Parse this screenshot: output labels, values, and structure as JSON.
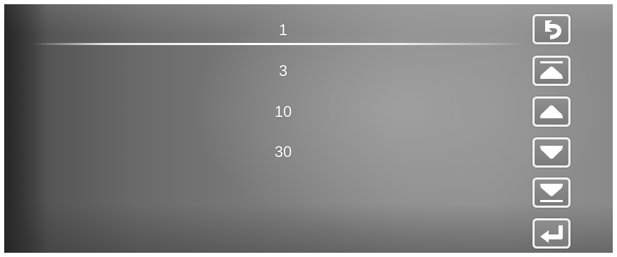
{
  "list": {
    "items": [
      {
        "label": "1"
      },
      {
        "label": "3"
      },
      {
        "label": "10"
      },
      {
        "label": "30"
      }
    ]
  },
  "side_buttons": [
    {
      "icon": "back-icon"
    },
    {
      "icon": "scroll-to-top-icon"
    },
    {
      "icon": "arrow-up-icon"
    },
    {
      "icon": "arrow-down-icon"
    },
    {
      "icon": "scroll-to-bottom-icon"
    },
    {
      "icon": "enter-icon"
    }
  ],
  "colors": {
    "text": "#ffffff",
    "button_border": "#f2f2f2",
    "button_fill": "#858585"
  }
}
